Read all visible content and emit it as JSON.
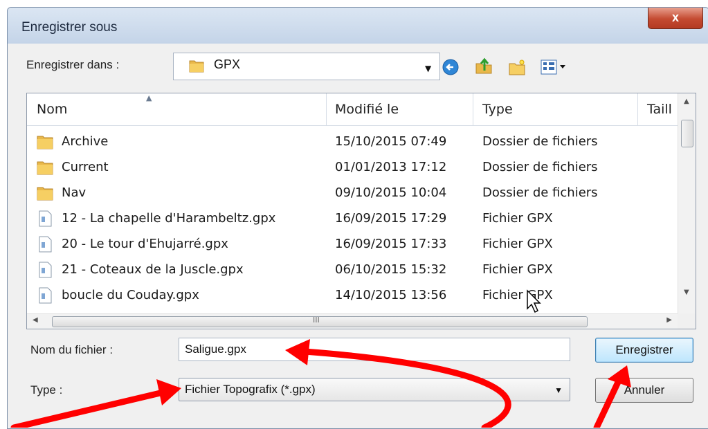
{
  "window": {
    "title": "Enregistrer sous",
    "close_glyph": "x"
  },
  "toolbar": {
    "save_in_label": "Enregistrer dans :",
    "location": "GPX",
    "icons": [
      "back-icon",
      "up-folder-icon",
      "new-folder-icon",
      "view-menu-icon"
    ]
  },
  "file_list": {
    "columns": [
      "Nom",
      "Modifié le",
      "Type",
      "Taill"
    ],
    "rows": [
      {
        "icon": "folder-icon",
        "name": "Archive",
        "modified": "15/10/2015 07:49",
        "type": "Dossier de fichiers"
      },
      {
        "icon": "folder-icon",
        "name": "Current",
        "modified": "01/01/2013 17:12",
        "type": "Dossier de fichiers"
      },
      {
        "icon": "folder-icon",
        "name": "Nav",
        "modified": "09/10/2015 10:04",
        "type": "Dossier de fichiers"
      },
      {
        "icon": "file-icon",
        "name": "12 - La chapelle d'Harambeltz.gpx",
        "modified": "16/09/2015 17:29",
        "type": "Fichier GPX"
      },
      {
        "icon": "file-icon",
        "name": "20 - Le tour d'Ehujarré.gpx",
        "modified": "16/09/2015 17:33",
        "type": "Fichier GPX"
      },
      {
        "icon": "file-icon",
        "name": "21 - Coteaux de la Juscle.gpx",
        "modified": "06/10/2015 15:32",
        "type": "Fichier GPX"
      },
      {
        "icon": "file-icon",
        "name": "boucle du Couday.gpx",
        "modified": "14/10/2015 13:56",
        "type": "Fichier GPX"
      }
    ],
    "hscroll_grip": "III"
  },
  "form": {
    "filename_label": "Nom du fichier :",
    "filename_value": "Saligue.gpx",
    "type_label": "Type :",
    "type_value": "Fichier Topografix (*.gpx)"
  },
  "buttons": {
    "save": "Enregistrer",
    "cancel": "Annuler"
  },
  "annotation_color": "#ff0000"
}
